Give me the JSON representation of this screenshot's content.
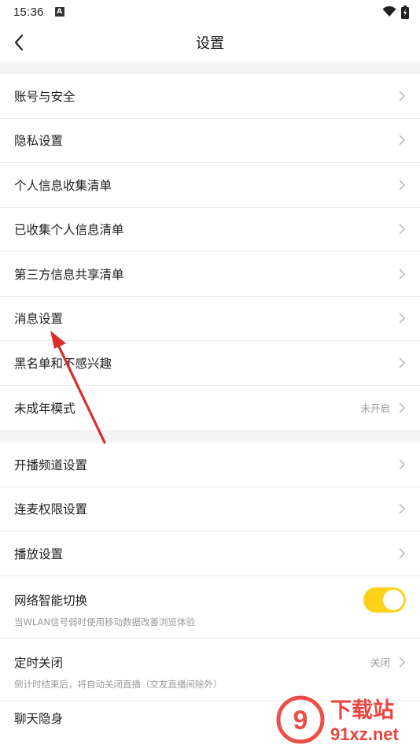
{
  "status_bar": {
    "time": "15:36",
    "a_badge": "A"
  },
  "header": {
    "title": "设置",
    "back_icon": "chevron-left-icon"
  },
  "group1": [
    {
      "label": "账号与安全"
    },
    {
      "label": "隐私设置"
    },
    {
      "label": "个人信息收集清单"
    },
    {
      "label": "已收集个人信息清单"
    },
    {
      "label": "第三方信息共享清单"
    },
    {
      "label": "消息设置"
    },
    {
      "label": "黑名单和不感兴趣"
    },
    {
      "label": "未成年模式",
      "value": "未开启"
    }
  ],
  "group2": [
    {
      "label": "开播频道设置"
    },
    {
      "label": "连麦权限设置"
    },
    {
      "label": "播放设置"
    }
  ],
  "network": {
    "label": "网络智能切换",
    "sub": "当WLAN信号弱时使用移动数据改善浏览体验",
    "enabled": true
  },
  "timer": {
    "label": "定时关闭",
    "value": "关闭",
    "sub": "倒计时结束后，将自动关闭直播（交友直播间除外）"
  },
  "chat": {
    "label": "聊天隐身"
  },
  "watermark": {
    "brand": "下载站",
    "domain": "91xz.net",
    "logo": "9"
  },
  "colors": {
    "accent": "#ffd21a",
    "arrow": "#d9302c",
    "watermark_red": "#e8302a"
  }
}
